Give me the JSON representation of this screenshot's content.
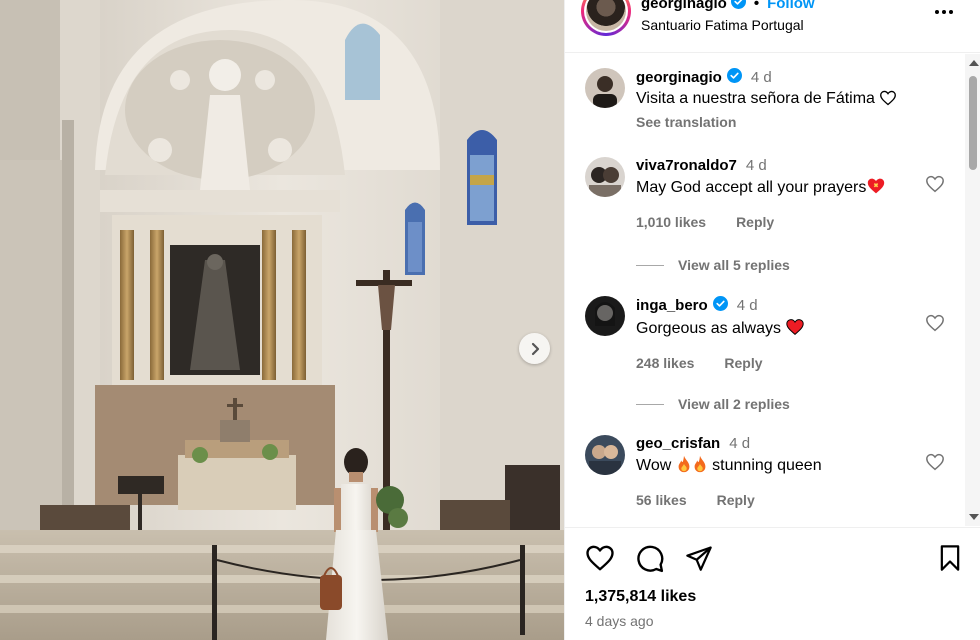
{
  "post": {
    "username": "georginagio",
    "follow_label": "Follow",
    "location": "Santuario Fatima Portugal",
    "likes": "1,375,814 likes",
    "posted": "4 days ago"
  },
  "comments": [
    {
      "username": "georginagio",
      "verified": true,
      "time": "4 d",
      "text": "Visita a nuestra señora de Fátima",
      "translate": "See translation"
    },
    {
      "username": "viva7ronaldo7",
      "verified": false,
      "time": "4 d",
      "text": "May God accept all your prayers",
      "likes": "1,010 likes",
      "reply": "Reply",
      "view_replies": "View all 5 replies"
    },
    {
      "username": "inga_bero",
      "verified": true,
      "time": "4 d",
      "text": "Gorgeous as always",
      "likes": "248 likes",
      "reply": "Reply",
      "view_replies": "View all 2 replies"
    },
    {
      "username": "geo_crisfan",
      "verified": false,
      "time": "4 d",
      "text_before": "Wow",
      "text_after": "stunning queen",
      "likes": "56 likes",
      "reply": "Reply"
    }
  ],
  "icons": {
    "next": "chevron-right-icon",
    "more": "more-options-icon",
    "like": "heart-icon",
    "comment": "comment-icon",
    "share": "share-icon",
    "save": "bookmark-icon",
    "verified": "verified-badge-icon"
  },
  "colors": {
    "accent": "#0095f6",
    "secondary_text": "#737373",
    "heart_red": "#ed1c24"
  }
}
